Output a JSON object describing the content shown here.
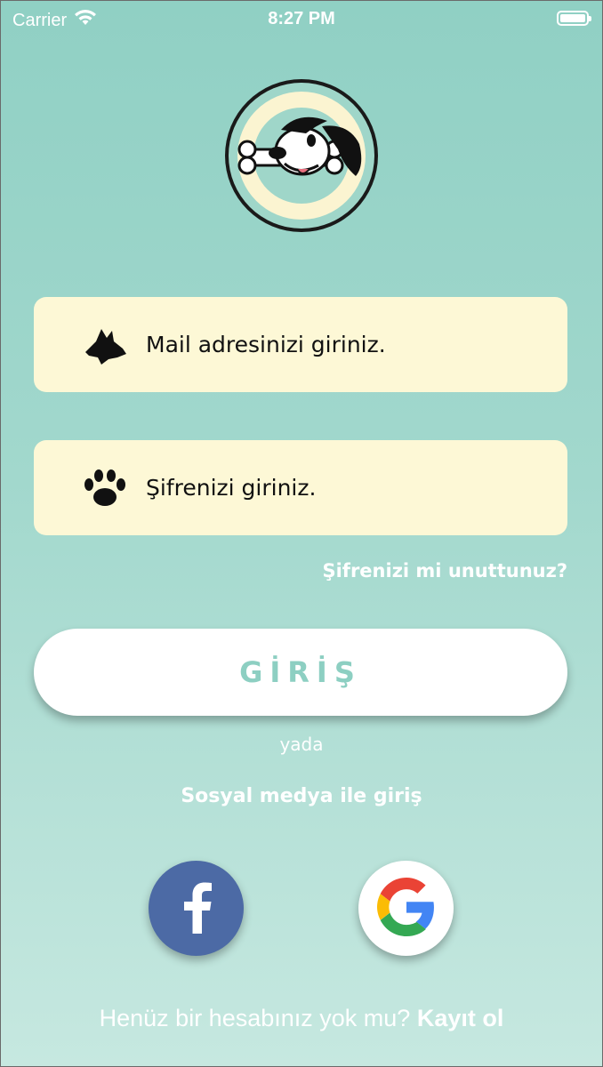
{
  "status_bar": {
    "carrier": "Carrier",
    "time": "8:27 PM"
  },
  "login": {
    "email_placeholder": "Mail adresinizi giriniz.",
    "password_placeholder": "Şifrenizi giriniz.",
    "forgot_label": "Şifrenizi mi unuttunuz?",
    "login_button": "GİRİŞ",
    "or_label": "yada",
    "social_label": "Sosyal medya ile giriş"
  },
  "signup": {
    "prompt": "Henüz bir hesabınız yok mu?",
    "link": "Kayıt ol"
  },
  "icons": {
    "logo": "dog-bone-logo-icon",
    "email_field": "dog-head-icon",
    "password_field": "paw-icon",
    "facebook": "facebook-icon",
    "google": "google-icon"
  },
  "colors": {
    "background_top": "#90d0c4",
    "background_bottom": "#c6e8e0",
    "field_bg": "#fdf8d6",
    "accent": "#8dcfc2",
    "facebook": "#4c6aa5"
  }
}
